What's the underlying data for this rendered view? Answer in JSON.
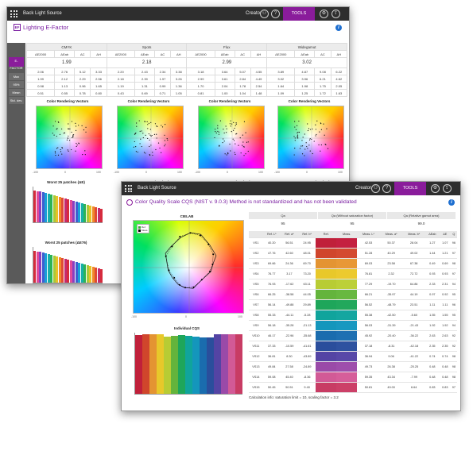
{
  "winA": {
    "topbar": {
      "app_title": "Back Light Source",
      "creator": "Creator",
      "tools": "TOOLS",
      "user_icon": "user-icon",
      "help_icon": "help-icon",
      "gear_icon": "gear-icon"
    },
    "title": "Lighting E-Factor",
    "badge": "EF",
    "sidebar": [
      "E-FACTOR",
      "Max",
      "95%",
      "Mean",
      "Std. dev."
    ],
    "groups": [
      {
        "name": "CMYK",
        "score": "1.99",
        "rows": [
          [
            "2.06",
            "2.76",
            "5.12",
            "3.33"
          ],
          [
            "1.99",
            "2.12",
            "2.29",
            "2.56"
          ],
          [
            "0.98",
            "1.13",
            "0.96",
            "1.65"
          ],
          [
            "0.51",
            "0.55",
            "0.78",
            "0.80"
          ]
        ]
      },
      {
        "name": "Spots",
        "score": "2.18",
        "rows": [
          [
            "2.20",
            "2.43",
            "2.34",
            "3.38"
          ],
          [
            "2.18",
            "2.39",
            "1.97",
            "3.26"
          ],
          [
            "1.19",
            "1.31",
            "0.99",
            "1.36"
          ],
          [
            "0.43",
            "0.69",
            "0.71",
            "1.05"
          ]
        ]
      },
      {
        "name": "Flux",
        "score": "2.99",
        "rows": [
          [
            "3.18",
            "3.64",
            "5.07",
            "4.55"
          ],
          [
            "2.99",
            "3.61",
            "2.84",
            "4.49"
          ],
          [
            "1.70",
            "2.04",
            "1.78",
            "2.54"
          ],
          [
            "0.81",
            "1.00",
            "1.04",
            "1.48"
          ]
        ]
      },
      {
        "name": "Widegamut",
        "score": "3.02",
        "rows": [
          [
            "3.89",
            "4.87",
            "9.08",
            "6.22"
          ],
          [
            "3.02",
            "3.96",
            "6.21",
            "4.62"
          ],
          [
            "1.64",
            "1.98",
            "1.75",
            "2.05"
          ],
          [
            "1.09",
            "1.25",
            "1.72",
            "1.63"
          ]
        ]
      }
    ],
    "col_headers": [
      "ΔE2000",
      "ΔEab",
      "ΔC",
      "ΔH"
    ],
    "vectors_title": "Color Rendering Vectors",
    "worst_title": "Worst 25 patches (ΔE)",
    "worst_title_76": "Worst 25 patches (ΔE76)",
    "axis_ticks": [
      "-100",
      "0",
      "100"
    ]
  },
  "winB": {
    "topbar": {
      "app_title": "Back Light Source",
      "creator": "Creator",
      "tools": "TOOLS"
    },
    "title": "Color Quality Scale CQS (NIST v. 9.0.3) Method is not standardized and has not been validated",
    "summary": [
      {
        "label": "Qa",
        "value": "95"
      },
      {
        "label": "Qa (Without saturation factor)",
        "value": "95"
      },
      {
        "label": "Qa (Relative gamut area)",
        "value": "99.0"
      }
    ],
    "cielab_title": "CIELAB",
    "legend": [
      "Ref.",
      "Meas."
    ],
    "icqs_title": "Individual CQS",
    "table_headers": [
      "",
      "Ref. L*",
      "Ref. a*",
      "Ref. b*",
      "Ref.",
      "Meas.",
      "Meas. L*",
      "Meas. a*",
      "Meas. b*",
      "ΔEab",
      "ΔE",
      "Q"
    ],
    "rows": [
      [
        "VS1",
        "40.20",
        "56.51",
        "24.95",
        "#c0203a",
        "#c42040",
        "42.53",
        "50.37",
        "28.04",
        "1.27",
        "1.07",
        "96"
      ],
      [
        "VS2",
        "47.76",
        "42.60",
        "48.01",
        "#d0462c",
        "#d44a30",
        "51.28",
        "40.29",
        "49.02",
        "1.44",
        "1.21",
        "97"
      ],
      [
        "VS3",
        "69.66",
        "24.36",
        "69.70",
        "#e49432",
        "#e89836",
        "69.03",
        "23.58",
        "67.38",
        "0.49",
        "0.69",
        "98"
      ],
      [
        "VS4",
        "76.77",
        "3.17",
        "73.20",
        "#e8c82a",
        "#ecca2e",
        "76.81",
        "2.32",
        "72.72",
        "0.93",
        "0.93",
        "97"
      ],
      [
        "VS5",
        "76.93",
        "-17.62",
        "63.11",
        "#b8cc34",
        "#bcd038",
        "77.29",
        "-19.70",
        "64.86",
        "2.33",
        "2.31",
        "94"
      ],
      [
        "VS6",
        "66.25",
        "-38.58",
        "44.05",
        "#64b43c",
        "#68b840",
        "66.21",
        "-35.97",
        "44.19",
        "0.97",
        "0.92",
        "95"
      ],
      [
        "VS7",
        "56.14",
        "-49.88",
        "29.89",
        "#1ea65a",
        "#22a85c",
        "56.52",
        "-48.79",
        "23.51",
        "1.11",
        "1.11",
        "96"
      ],
      [
        "VS8",
        "55.33",
        "-44.11",
        "-5.28",
        "#10a49c",
        "#14a6a0",
        "55.38",
        "-42.50",
        "-5.60",
        "1.55",
        "1.55",
        "95"
      ],
      [
        "VS9",
        "56.18",
        "-35.28",
        "-21.13",
        "#1496bc",
        "#1898c0",
        "56.03",
        "-31.39",
        "-21.43",
        "1.92",
        "1.92",
        "94"
      ],
      [
        "VS10",
        "46.17",
        "-22.96",
        "-35.68",
        "#1a6cae",
        "#1e70b2",
        "45.92",
        "-20.40",
        "-36.22",
        "2.63",
        "2.63",
        "92"
      ],
      [
        "VS11",
        "37.33",
        "-10.59",
        "-41.61",
        "#2a4e9c",
        "#2e52a0",
        "37.18",
        "-8.31",
        "-42.18",
        "2.35",
        "2.35",
        "92"
      ],
      [
        "VS12",
        "36.81",
        "8.30",
        "-43.89",
        "#5444a4",
        "#5848a8",
        "36.94",
        "9.06",
        "-41.22",
        "0.74",
        "0.74",
        "98"
      ],
      [
        "VS13",
        "49.84",
        "27.58",
        "-24.89",
        "#9a4aa8",
        "#9e4eac",
        "49.73",
        "26.38",
        "-25.25",
        "0.48",
        "0.48",
        "98"
      ],
      [
        "VS14",
        "59.08",
        "45.40",
        "-8.36",
        "#d25a96",
        "#d65e9a",
        "59.35",
        "43.34",
        "-7.99",
        "0.48",
        "0.48",
        "98"
      ],
      [
        "VS15",
        "50.45",
        "50.51",
        "9.40",
        "#c83c64",
        "#cc4068",
        "50.81",
        "49.00",
        "6.64",
        "0.83",
        "0.83",
        "97"
      ]
    ],
    "note": "Calculation info: saturation limit = 10, scaling factor = 3.2"
  }
}
